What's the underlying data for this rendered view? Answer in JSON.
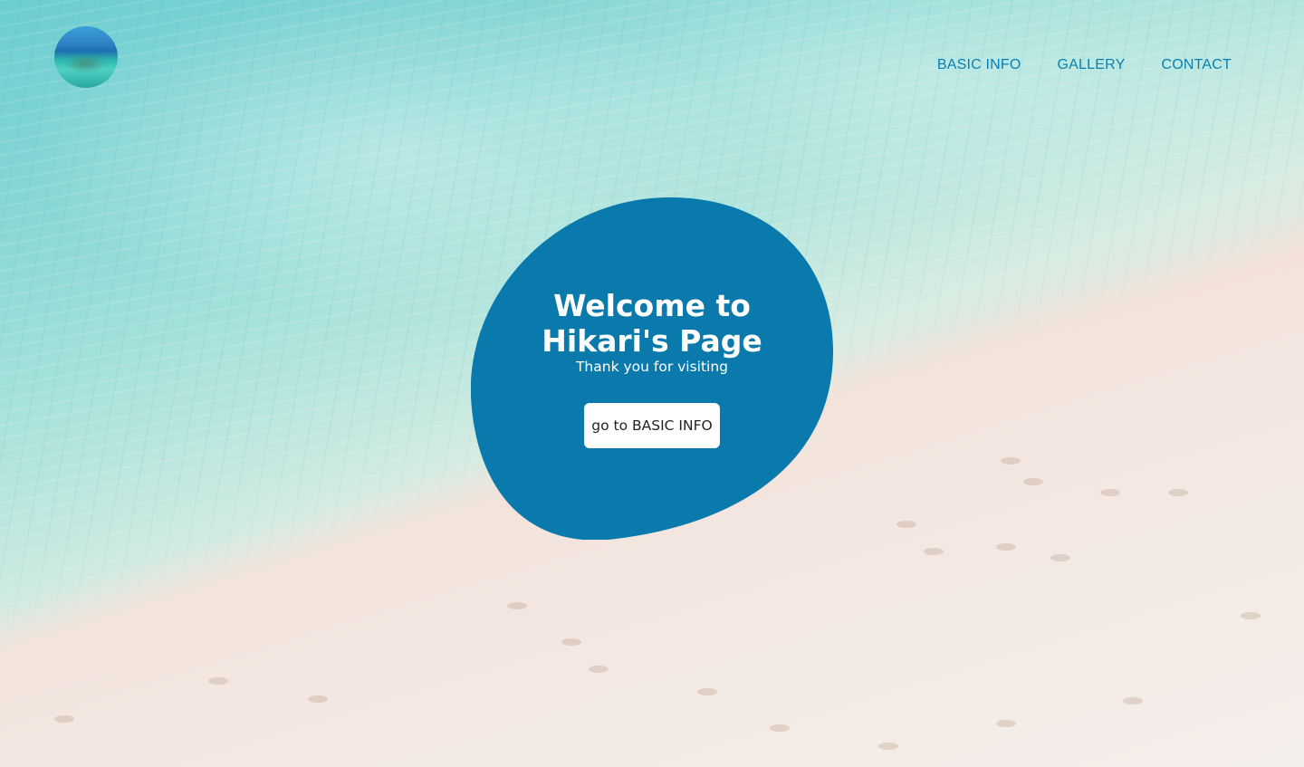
{
  "header": {
    "logo_alt": "beach logo",
    "nav": [
      {
        "label": "BASIC INFO"
      },
      {
        "label": "GALLERY"
      },
      {
        "label": "CONTACT"
      }
    ]
  },
  "hero": {
    "title": "Welcome to Hikari's Page",
    "subtitle": "Thank you for visiting",
    "button_label": "go to BASIC INFO"
  },
  "colors": {
    "accent": "#0a7aad",
    "nav_text": "#0a7fb0",
    "button_bg": "#ffffff",
    "button_text": "#222222"
  }
}
